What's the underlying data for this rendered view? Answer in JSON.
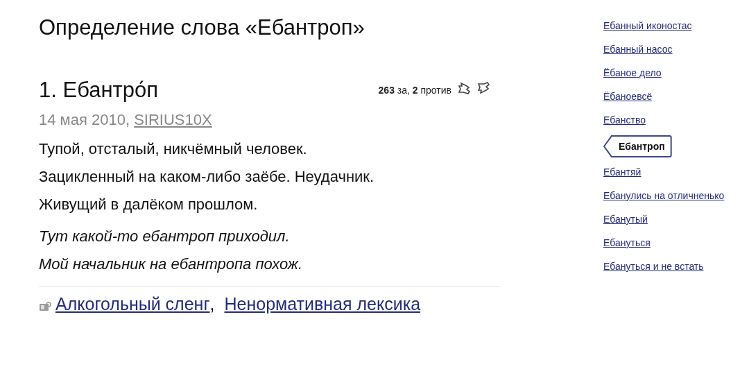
{
  "page_title": "Определение слова «Ебантроп»",
  "entry": {
    "heading": "1. Ебантро́п",
    "votes": "**263** за, **2** против",
    "date": "14 мая 2010,",
    "author": "SIRIUS10X",
    "definition": [
      "Тупой, отсталый, никчёмный человек.",
      "Зацикленный на каком-либо заёбе. Неудачник.",
      "Живущий в далёком прошлом."
    ],
    "examples": [
      "Тут какой-то ебантроп приходил.",
      "Мой начальник на ебантропа похож."
    ],
    "categories": [
      "Алкогольный сленг",
      "Ненормативная лексика"
    ],
    "category_separator": ","
  },
  "sidebar": {
    "items": [
      {
        "label": "Ебанный иконостас",
        "selected": false
      },
      {
        "label": "Ебанный насос",
        "selected": false
      },
      {
        "label": "Ёбаное дело",
        "selected": false
      },
      {
        "label": "Ёбаноевсё",
        "selected": false
      },
      {
        "label": "Ебанство",
        "selected": false
      },
      {
        "label": "Ебантроп",
        "selected": true
      },
      {
        "label": "Ебантяй",
        "selected": false
      },
      {
        "label": "Ебанулись на отличненько",
        "selected": false
      },
      {
        "label": "Ебанутый",
        "selected": false
      },
      {
        "label": "Ебануться",
        "selected": false
      },
      {
        "label": "Ебануться и не встать",
        "selected": false
      }
    ]
  }
}
